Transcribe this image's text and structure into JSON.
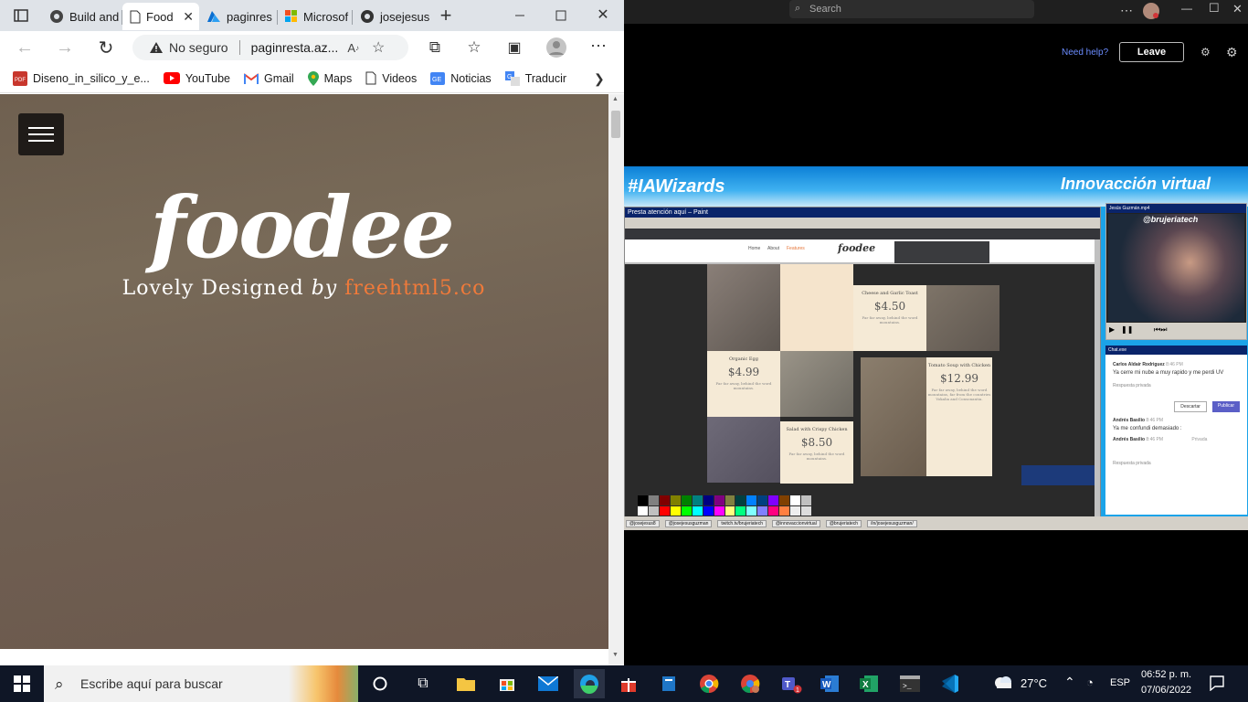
{
  "browser": {
    "tabs": [
      {
        "label": "Build and",
        "icon": "github-icon"
      },
      {
        "label": "Food",
        "icon": "page-icon",
        "active": true
      },
      {
        "label": "paginres",
        "icon": "azure-icon"
      },
      {
        "label": "Microsof",
        "icon": "microsoft-icon"
      },
      {
        "label": "josejesus",
        "icon": "github-icon"
      }
    ],
    "address": {
      "security": "No seguro",
      "url": "paginresta.az..."
    },
    "bookmarks": [
      "Diseno_in_silico_y_e...",
      "YouTube",
      "Gmail",
      "Maps",
      "Videos",
      "Noticias",
      "Traducir"
    ]
  },
  "site": {
    "logo": "foodee",
    "tagline_lead": "Lovely Designed",
    "tagline_by": "by",
    "tagline_brand": "freehtml5.co"
  },
  "teams": {
    "search_placeholder": "Search",
    "need_help": "Need help?",
    "leave": "Leave"
  },
  "stream": {
    "hashtag": "#IAWizards",
    "header": "Innovacción virtual",
    "paint_title": "Presta atención aquí – Paint",
    "inner_nav": [
      "Home",
      "About",
      "Features"
    ],
    "inner_logo": "foodee",
    "cards": [
      {
        "title": "Cheese and Garlic Toast",
        "price": "$4.50",
        "desc": "Far far away, behind the word mountains."
      },
      {
        "title": "Organic Egg",
        "price": "$4.99",
        "desc": "Far far away, behind the word mountains."
      },
      {
        "title": "Tomato Soup with Chicken",
        "price": "$12.99",
        "desc": "Far far away, behind the word mountains, far from the countries Vokalia and Consonantia."
      },
      {
        "title": "Salad with Crispy Chicken",
        "price": "$8.50",
        "desc": "Far far away, behind the word mountains."
      }
    ],
    "webcam_title": "Jesús Guzmán.mp4",
    "webcam_handle": "@brujeriatech",
    "chat": {
      "title": "Chat.exe",
      "messages": [
        {
          "author": "Carlos Aldair Rodriguez",
          "time": "8:46 PM",
          "text": "Ya cerre mi nube a muy rapido y me perdi UV"
        },
        {
          "author": "Andrés Basilio",
          "time": "8:46 PM",
          "text": "Ya me confundi demasiado :"
        },
        {
          "author": "Andrés Basilio",
          "time": "8:46 PM",
          "text": "Privada"
        }
      ],
      "reply": "Respuesta privada",
      "discard": "Descartar",
      "publish": "Publicar"
    },
    "socials": [
      "@josejesus8",
      "@josejesusguzman",
      "twitch.tv/brujeriatech",
      "@innovaccionvirtual",
      "@brujeriatech",
      "/in/josejesusguzman/"
    ]
  },
  "taskbar": {
    "search_placeholder": "Escribe aquí para buscar",
    "weather": "27°C",
    "lang": "ESP",
    "time": "06:52 p. m.",
    "date": "07/06/2022"
  }
}
